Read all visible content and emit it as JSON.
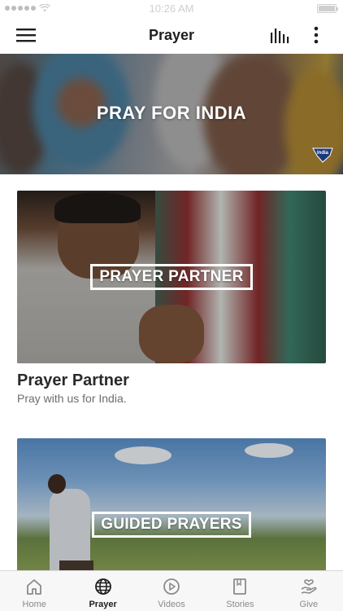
{
  "status_bar": {
    "time": "10:26 AM"
  },
  "nav": {
    "title": "Prayer",
    "menu_icon": "hamburger-menu-icon",
    "stats_icon": "bar-chart-icon",
    "more_icon": "more-vertical-icon"
  },
  "hero": {
    "title": "PRAY FOR INDIA",
    "logo_text": "India"
  },
  "cards": [
    {
      "image_label": "PRAYER PARTNER",
      "title": "Prayer Partner",
      "subtitle": "Pray with us for India."
    },
    {
      "image_label": "GUIDED PRAYERS"
    }
  ],
  "tabs": [
    {
      "label": "Home",
      "icon": "home-icon",
      "active": false
    },
    {
      "label": "Prayer",
      "icon": "globe-icon",
      "active": true
    },
    {
      "label": "Videos",
      "icon": "play-circle-icon",
      "active": false
    },
    {
      "label": "Stories",
      "icon": "book-icon",
      "active": false
    },
    {
      "label": "Give",
      "icon": "give-hand-heart-icon",
      "active": false
    }
  ],
  "colors": {
    "active_tab": "#1f1f1f",
    "inactive_tab": "#8a8a8a",
    "tab_bar_bg": "#f7f7f7"
  }
}
